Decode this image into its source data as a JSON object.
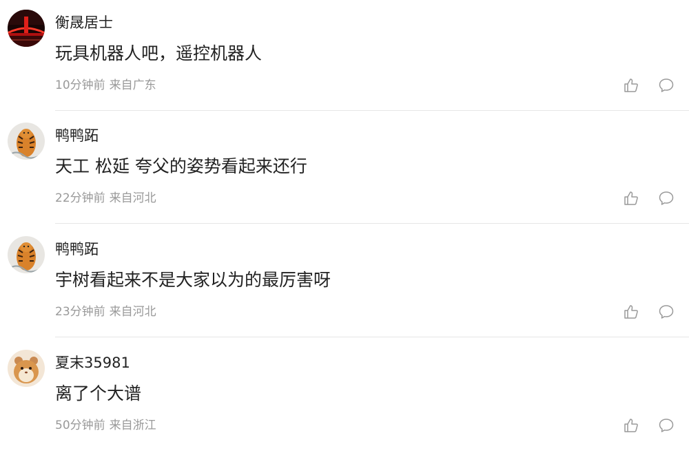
{
  "comments": [
    {
      "username": "衡晟居士",
      "text": "玩具机器人吧，遥控机器人",
      "time": "10分钟前",
      "location": "来自广东",
      "avatar": "red-bridge-night-avatar"
    },
    {
      "username": "鸭鸭跖",
      "text": "天工 松延 夸父的姿势看起来还行",
      "time": "22分钟前",
      "location": "来自河北",
      "avatar": "tiger-avatar"
    },
    {
      "username": "鸭鸭跖",
      "text": "宇树看起来不是大家以为的最厉害呀",
      "time": "23分钟前",
      "location": "来自河北",
      "avatar": "tiger-avatar"
    },
    {
      "username": "夏末35981",
      "text": "离了个大谱",
      "time": "50分钟前",
      "location": "来自浙江",
      "avatar": "hamster-avatar"
    }
  ],
  "icons": {
    "like": "thumbs-up-icon",
    "reply": "speech-bubble-icon"
  },
  "colors": {
    "text": "#222222",
    "meta": "#999999",
    "icon": "#999999",
    "divider": "#e6e6e6"
  }
}
